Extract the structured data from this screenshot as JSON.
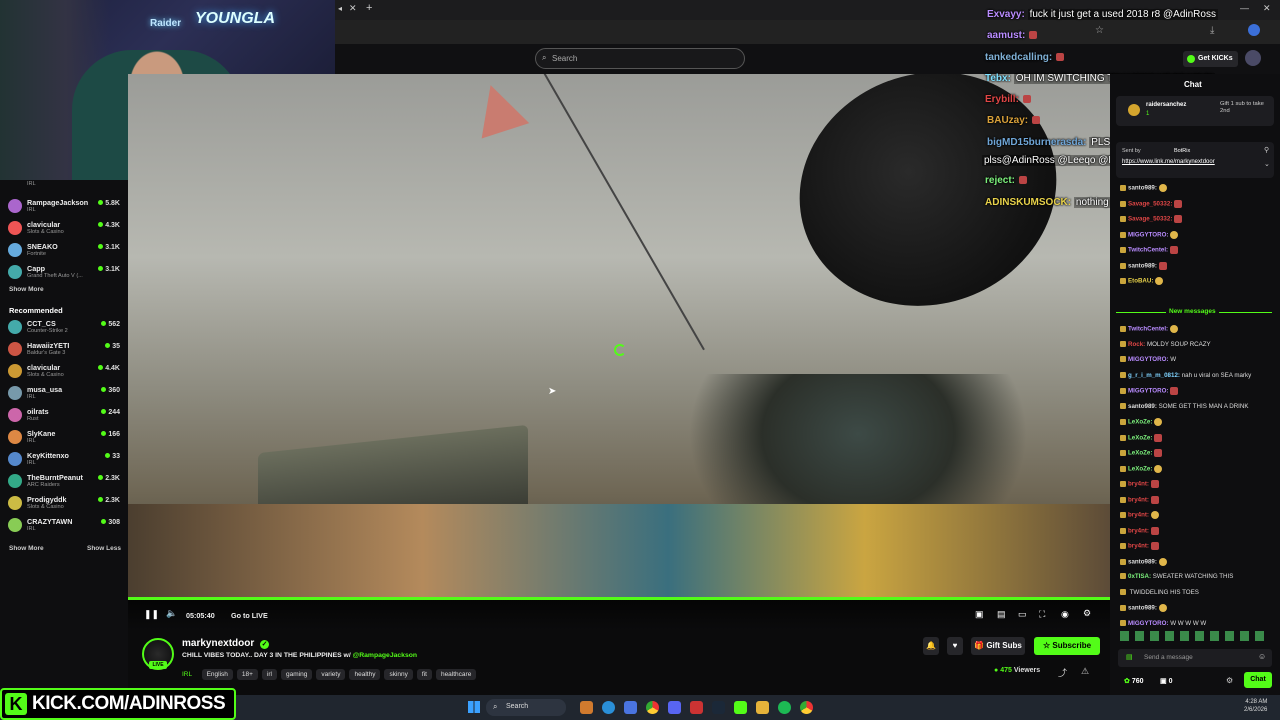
{
  "site": {
    "search_placeholder": "Search"
  },
  "sidebar": {
    "top_items": [
      {
        "name": "RampageJackson",
        "category": "IRL",
        "viewers": "5.8K"
      },
      {
        "name": "clavicular",
        "category": "Slots & Casino",
        "viewers": "4.3K"
      },
      {
        "name": "SNEAKO",
        "category": "Fortnite",
        "viewers": "3.1K"
      },
      {
        "name": "Capp",
        "category": "Grand Theft Auto V (...",
        "viewers": "3.1K"
      }
    ],
    "cut_category": "IRL",
    "show_more": "Show More",
    "recommended_title": "Recommended",
    "recommended": [
      {
        "name": "CCT_CS",
        "category": "Counter-Strike 2",
        "viewers": "562"
      },
      {
        "name": "HawaiizYETI",
        "category": "Baldur's Gate 3",
        "viewers": "35"
      },
      {
        "name": "clavicular",
        "category": "Slots & Casino",
        "viewers": "4.4K"
      },
      {
        "name": "musa_usa",
        "category": "IRL",
        "viewers": "360"
      },
      {
        "name": "oilrats",
        "category": "Rust",
        "viewers": "244"
      },
      {
        "name": "SlyKane",
        "category": "IRL",
        "viewers": "166"
      },
      {
        "name": "KeyKittenxo",
        "category": "IRL",
        "viewers": "33"
      },
      {
        "name": "TheBurntPeanut",
        "category": "ARC Raiders",
        "viewers": "2.3K"
      },
      {
        "name": "Prodigyddk",
        "category": "Slots & Casino",
        "viewers": "2.3K"
      },
      {
        "name": "CRAZYTAWN",
        "category": "IRL",
        "viewers": "308"
      }
    ],
    "show_more_2": "Show More",
    "show_less": "Show Less"
  },
  "webcam": {
    "neon_left": "Raider",
    "neon_right": "YOUNGLA"
  },
  "player": {
    "time": "05:05:40",
    "go_live": "Go to LIVE",
    "progress": 1.0
  },
  "overlay_chat": [
    {
      "user": "Exvayy:",
      "msg": "fuck it just get a used 2018 r8 @AdinRoss",
      "color": "#b98cff"
    },
    {
      "user": "aamust:",
      "msg": "",
      "color": "#b98cff"
    },
    {
      "user": "tankedcalling:",
      "msg": "",
      "color": "#7fb0d6"
    },
    {
      "user": "Tebx:",
      "msg": "OH IM SWITCHING TO WATCH THEM BYE",
      "color": "#7ee0ff"
    },
    {
      "user": "Erybill:",
      "msg": "",
      "color": "#e04646"
    },
    {
      "user": "BAUzay:",
      "msg": "",
      "color": "#d9a13a"
    },
    {
      "user": "bigMD15burnerasda:",
      "msg": "PLSSS dont forget twitter winners",
      "color": "#6fa6d8"
    },
    {
      "user": "",
      "msg": "plss@AdinRoss @Leeqo @PRIZ",
      "color": "#fff"
    },
    {
      "user": "reject:",
      "msg": "",
      "color": "#7cf07c"
    },
    {
      "user": "ADINSKUMSOCK:",
      "msg": "nothing happening",
      "color": "#e8d24a"
    }
  ],
  "channel": {
    "name": "markynextdoor",
    "title": "CHILL VIBES TODAY.. DAY 3 IN THE PHILIPPINES w/",
    "mention": "@RampageJackson",
    "category": "IRL",
    "tags": [
      "English",
      "18+",
      "irl",
      "gaming",
      "variety",
      "healthy",
      "skinny",
      "fit",
      "healthcare"
    ],
    "live_badge": "LIVE",
    "viewers": "475",
    "viewers_label": "Viewers"
  },
  "buttons": {
    "gift_subs": "Gift Subs",
    "subscribe": "Subscribe",
    "get_kicks": "Get KICKs"
  },
  "chat": {
    "title": "Chat",
    "pinned_user": "raidersanchez",
    "pinned_text": "Gift 1 sub to take 2nd",
    "pinned_count": "1",
    "bot_label": "Sent by",
    "bot_name": "BotRix",
    "bot_link": "https://www.link.me/markynextdoor",
    "new_messages": "New messages",
    "messages": [
      {
        "user": "santo989:",
        "msg": "",
        "color": "#ddd"
      },
      {
        "user": "Savage_50332:",
        "msg": "",
        "color": "#e04646"
      },
      {
        "user": "Savage_50332:",
        "msg": "",
        "color": "#e04646"
      },
      {
        "user": "MIGGYTORO:",
        "msg": "",
        "color": "#b98cff"
      },
      {
        "user": "TwitchCentel:",
        "msg": "",
        "color": "#b98cff"
      },
      {
        "user": "santo989:",
        "msg": "",
        "color": "#ddd"
      },
      {
        "user": "EtoBAU:",
        "msg": "",
        "color": "#e8d24a"
      }
    ],
    "messages_after": [
      {
        "user": "TwitchCentel:",
        "msg": "",
        "color": "#b98cff"
      },
      {
        "user": "Rock:",
        "msg": "MOLDY SOUP RCAZY",
        "color": "#e04646"
      },
      {
        "user": "MIGGYTORO:",
        "msg": "W",
        "color": "#b98cff"
      },
      {
        "user": "g_r_i_m_m_0812:",
        "msg": "nah u viral on SEA marky",
        "color": "#7fd3ff"
      },
      {
        "user": "MIGGYTORO:",
        "msg": "",
        "color": "#b98cff"
      },
      {
        "user": "santo989:",
        "msg": "SOME GET THIS MAN A DRINK",
        "color": "#ddd"
      },
      {
        "user": "LeXoZe:",
        "msg": "",
        "color": "#7cf07c"
      },
      {
        "user": "LeXoZe:",
        "msg": "",
        "color": "#7cf07c"
      },
      {
        "user": "LeXoZe:",
        "msg": "",
        "color": "#7cf07c"
      },
      {
        "user": "LeXoZe:",
        "msg": "",
        "color": "#7cf07c"
      },
      {
        "user": "bry4nt:",
        "msg": "",
        "color": "#e04646"
      },
      {
        "user": "bry4nt:",
        "msg": "",
        "color": "#e04646"
      },
      {
        "user": "bry4nt:",
        "msg": "",
        "color": "#e04646"
      },
      {
        "user": "bry4nt:",
        "msg": "",
        "color": "#e04646"
      },
      {
        "user": "bry4nt:",
        "msg": "",
        "color": "#e04646"
      },
      {
        "user": "santo989:",
        "msg": "",
        "color": "#ddd"
      },
      {
        "user": "0xTISA:",
        "msg": "SWEATER WATCHING THIS",
        "color": "#7cf07c"
      },
      {
        "user": "",
        "msg": "TWIDDELING HIS TOES",
        "color": "#ddd"
      },
      {
        "user": "santo989:",
        "msg": "",
        "color": "#ddd"
      },
      {
        "user": "MIGGYTORO:",
        "msg": "W W W W W",
        "color": "#b98cff"
      }
    ],
    "input_placeholder": "Send a message",
    "points": "760",
    "secondary_count": "0",
    "send_label": "Chat"
  },
  "banner": {
    "text": "KICK.COM/ADINROSS",
    "k": "K"
  },
  "taskbar": {
    "search": "Search",
    "time": "4:28 AM",
    "date": "2/6/2026"
  },
  "colors": {
    "kick_green": "#53fc18",
    "bg": "#0b0b0c"
  }
}
